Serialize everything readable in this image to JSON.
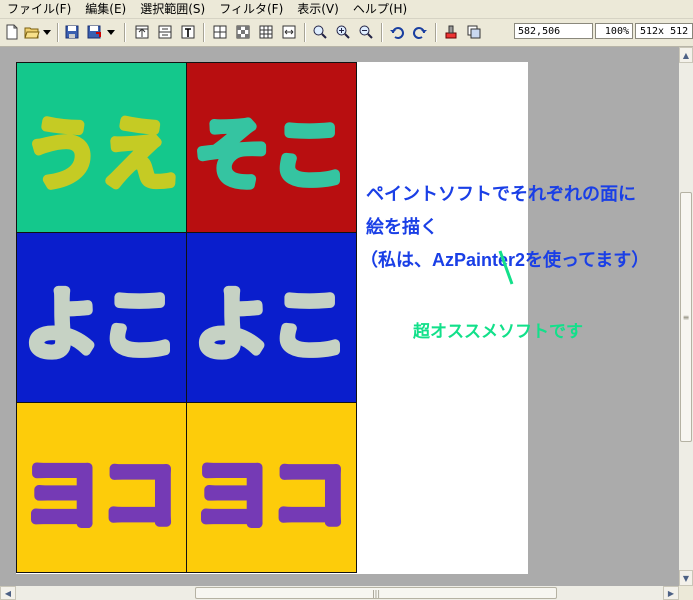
{
  "menu": [
    "ファイル(F)",
    "編集(E)",
    "選択範囲(S)",
    "フィルタ(F)",
    "表示(V)",
    "ヘルプ(H)"
  ],
  "status": {
    "coords": "582,506",
    "zoom": "100%",
    "size": "512x 512"
  },
  "icons": [
    "new-icon",
    "open-icon",
    "dropdown-icon",
    "save-icon",
    "save-as-icon",
    "dropdown-icon",
    "align-top-icon",
    "align-middle-icon",
    "text-icon",
    "crosshair-icon",
    "checker-icon",
    "grid-icon",
    "fit-width-icon",
    "zoom-icon",
    "zoom-in-icon",
    "zoom-out-icon",
    "undo-icon",
    "redo-icon",
    "paint-icon",
    "layers-icon"
  ],
  "tiles": [
    {
      "text": "うえ",
      "bg": "#14c88c",
      "stroke": "#d4cc1c"
    },
    {
      "text": "そこ",
      "bg": "#b80e10",
      "stroke": "#2ad4ae"
    },
    {
      "text": "よこ",
      "bg": "#0a1ecc",
      "stroke": "#d6e2c4"
    },
    {
      "text": "よこ",
      "bg": "#0a1ecc",
      "stroke": "#d6e2c4"
    },
    {
      "text": "ヨコ",
      "bg": "#fdcc0a",
      "stroke": "#6a2ec4"
    },
    {
      "text": "ヨコ",
      "bg": "#fdcc0a",
      "stroke": "#6a2ec4"
    }
  ],
  "annotation": {
    "line1": "ペイントソフトでそれぞれの面に",
    "line2": "絵を描く",
    "line3": "（私は、AzPainter2を使ってます）",
    "note": "超オススメソフトです",
    "blue": "#1a3fe6",
    "green": "#12e08a"
  }
}
